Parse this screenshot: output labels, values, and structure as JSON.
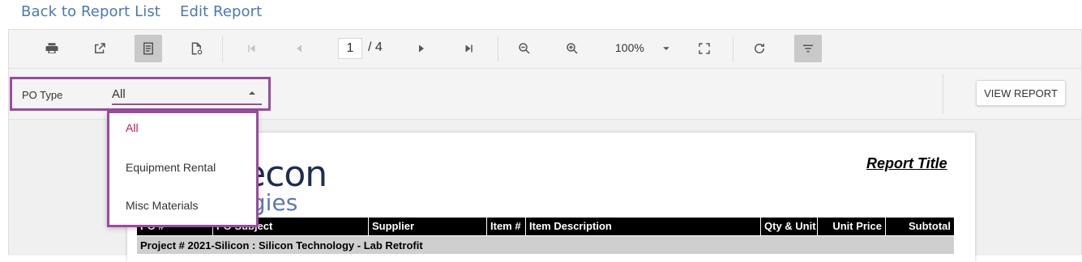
{
  "top_links": {
    "back": "Back to Report List",
    "edit": "Edit Report"
  },
  "toolbar": {
    "page_current": "1",
    "page_total": "/ 4",
    "zoom": "100%"
  },
  "params": {
    "po_type_label": "PO Type",
    "po_type_value": "All",
    "view_report": "VIEW REPORT"
  },
  "dropdown": {
    "options": [
      "All",
      "Equipment Rental",
      "Misc Materials"
    ]
  },
  "report": {
    "logo_line1": "recon",
    "logo_line2": "logies",
    "title": "Report Title",
    "columns": [
      "PO #",
      "PO Subject",
      "Supplier",
      "Item #",
      "Item Description",
      "Qty & Unit",
      "Unit Price",
      "Subtotal"
    ],
    "group_row": "Project # 2021-Silicon : Silicon Technology - Lab Retrofit"
  },
  "colors": {
    "accent": "#9b4aa0",
    "link": "#4a78b5",
    "selected_option": "#c2185b"
  }
}
